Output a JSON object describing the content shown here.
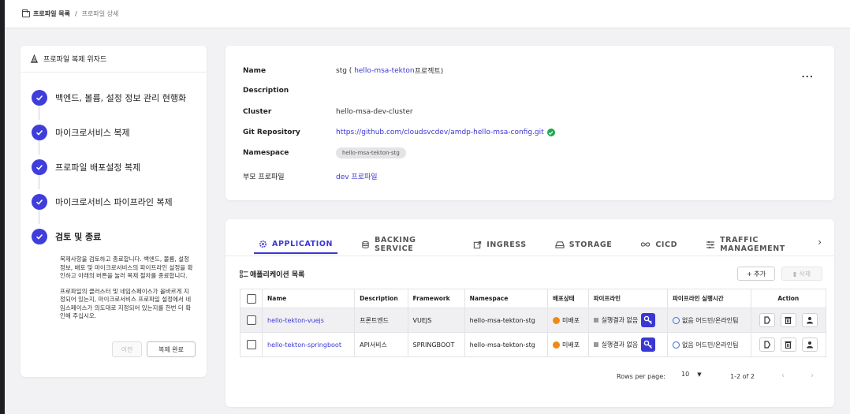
{
  "breadcrumb": {
    "root": "프로파일 목록",
    "separator": "/",
    "current": "프로파일 상세"
  },
  "wizard": {
    "title": "프로파일 복제 위자드",
    "steps": [
      {
        "label": "백엔드, 볼륨, 설정 정보 관리 현행화"
      },
      {
        "label": "마이크로서비스 복제"
      },
      {
        "label": "프로파일 배포설정 복제"
      },
      {
        "label": "마이크로서비스 파이프라인 복제"
      },
      {
        "label": "검토 및 종료"
      }
    ],
    "description_1": "복제사항을 검토하고 종료합니다. 백엔드, 볼륨, 설정 정보, 배포 및 마이크로서비스의 파이프라인 설정을 확인하고 아래의 버튼을 눌러 복제 절차를 종료합니다.",
    "description_2": "프로파일의 클러스터 및 네임스페이스가 올바르게 지정되어 있는지, 마이크로서비스 프로파일 설정에서 네임스페이스가 의도대로 지정되어 있는지를 한번 더 확인해 주십시오.",
    "prev_label": "이전",
    "done_label": "복제 완료"
  },
  "info": {
    "name_key": "Name",
    "name_prefix": "stg (",
    "name_link": "hello-msa-tekton",
    "name_suffix": " 프로젝트)",
    "description_key": "Description",
    "cluster_key": "Cluster",
    "cluster_val": "hello-msa-dev-cluster",
    "git_key": "Git Repository",
    "git_val": "https://github.com/cloudsvcdev/amdp-hello-msa-config.git",
    "namespace_key": "Namespace",
    "namespace_val": "hello-msa-tekton-stg",
    "parent_key": "부모 프로파일",
    "parent_val": "dev 프로파일",
    "more_label": "..."
  },
  "tabs": [
    {
      "label": "APPLICATION",
      "icon": "gear-icon"
    },
    {
      "label": "BACKING SERVICE",
      "icon": "database-icon"
    },
    {
      "label": "INGRESS",
      "icon": "external-link-icon"
    },
    {
      "label": "STORAGE",
      "icon": "drive-icon"
    },
    {
      "label": "CICD",
      "icon": "infinity-icon"
    },
    {
      "label": "TRAFFIC MANAGEMENT",
      "icon": "traffic-icon"
    }
  ],
  "list": {
    "title": "애플리케이션 목록",
    "add_label": "+ 추가",
    "delete_label": "삭제",
    "columns": [
      "Name",
      "Description",
      "Framework",
      "Namespace",
      "배포상태",
      "파이프라인",
      "파이프라인 실행시간",
      "Action"
    ],
    "rows": [
      {
        "name": "hello-tekton-vuejs",
        "description": "프론트엔드",
        "framework": "VUEJS",
        "namespace": "hello-msa-tekton-stg",
        "deploy_status": "미배포",
        "pipeline": "실행결과 없음",
        "pipeline_time": "없음 어드민/온라인팀"
      },
      {
        "name": "hello-tekton-springboot",
        "description": "API서비스",
        "framework": "SPRINGBOOT",
        "namespace": "hello-msa-tekton-stg",
        "deploy_status": "미배포",
        "pipeline": "실행결과 없음",
        "pipeline_time": "없음 어드민/온라인팀"
      }
    ]
  },
  "pager": {
    "rows_per_page_label": "Rows per page:",
    "rows_per_page": "10",
    "range": "1-2 of 2"
  },
  "colors": {
    "accent": "#3a37d4",
    "success": "#1fa84d",
    "warning": "#ef8a15"
  }
}
